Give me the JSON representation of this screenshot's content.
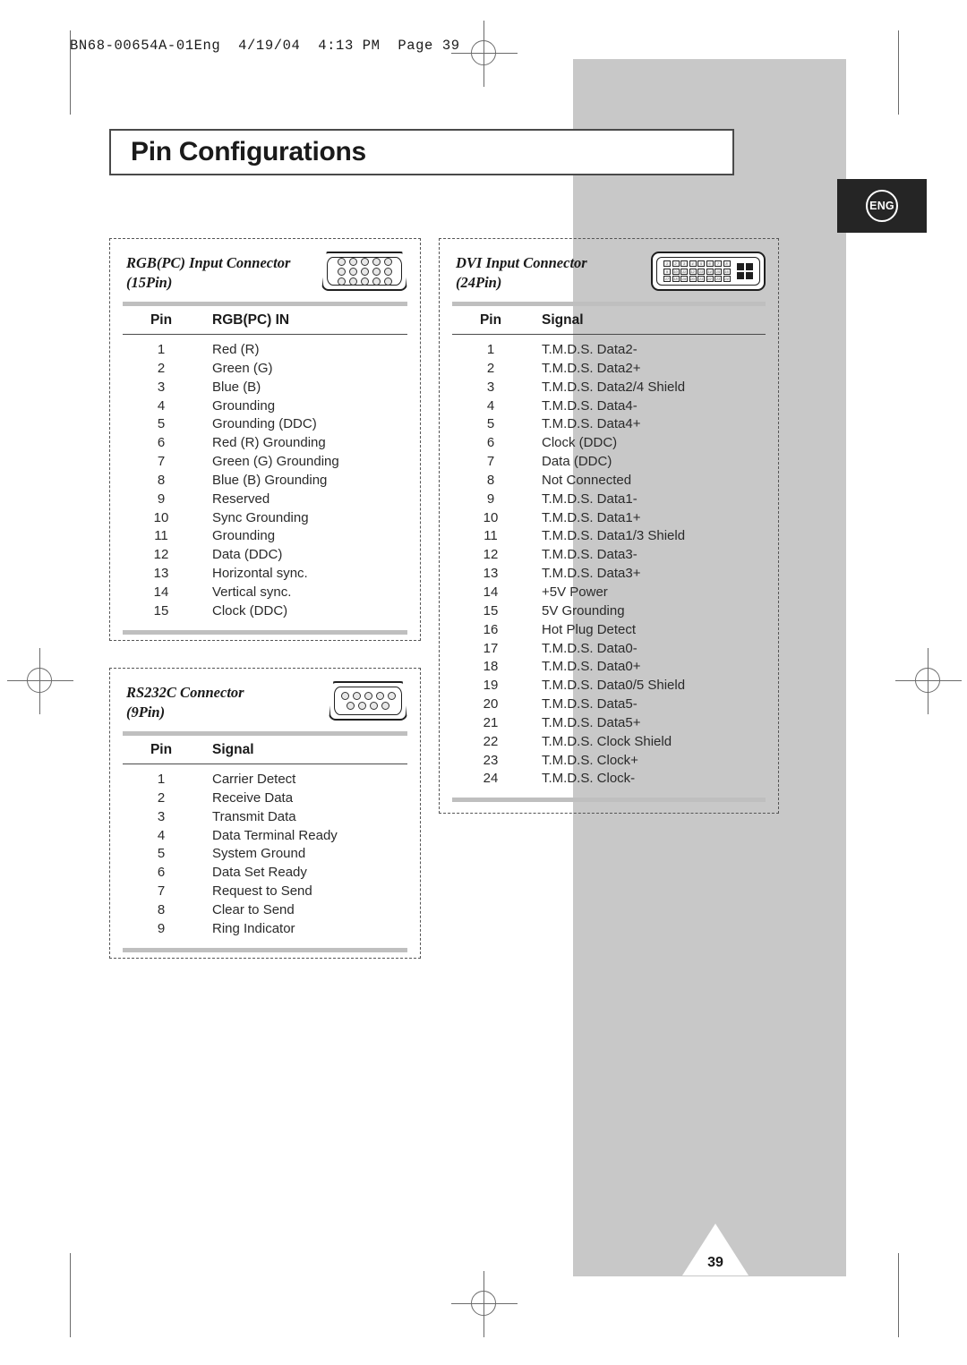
{
  "print_header": "BN68-00654A-01Eng  4/19/04  4:13 PM  Page 39",
  "page_title": "Pin Configurations",
  "language_badge": "ENG",
  "page_number": "39",
  "panels": [
    {
      "title": "RGB(PC) Input Connector",
      "subtitle": "(15Pin)",
      "connector_icon": "dsub-15pin-icon",
      "columns": [
        "Pin",
        "RGB(PC) IN"
      ],
      "rows": [
        [
          "1",
          "Red (R)"
        ],
        [
          "2",
          "Green (G)"
        ],
        [
          "3",
          "Blue (B)"
        ],
        [
          "4",
          "Grounding"
        ],
        [
          "5",
          "Grounding (DDC)"
        ],
        [
          "6",
          "Red (R) Grounding"
        ],
        [
          "7",
          "Green (G) Grounding"
        ],
        [
          "8",
          "Blue (B) Grounding"
        ],
        [
          "9",
          "Reserved"
        ],
        [
          "10",
          "Sync Grounding"
        ],
        [
          "11",
          "Grounding"
        ],
        [
          "12",
          "Data (DDC)"
        ],
        [
          "13",
          "Horizontal sync."
        ],
        [
          "14",
          "Vertical sync."
        ],
        [
          "15",
          "Clock (DDC)"
        ]
      ]
    },
    {
      "title": "DVI Input Connector",
      "subtitle": "(24Pin)",
      "connector_icon": "dvi-24pin-icon",
      "columns": [
        "Pin",
        "Signal"
      ],
      "rows": [
        [
          "1",
          "T.M.D.S. Data2-"
        ],
        [
          "2",
          "T.M.D.S. Data2+"
        ],
        [
          "3",
          "T.M.D.S. Data2/4 Shield"
        ],
        [
          "4",
          "T.M.D.S. Data4-"
        ],
        [
          "5",
          "T.M.D.S. Data4+"
        ],
        [
          "6",
          "Clock (DDC)"
        ],
        [
          "7",
          "Data (DDC)"
        ],
        [
          "8",
          "Not Connected"
        ],
        [
          "9",
          "T.M.D.S. Data1-"
        ],
        [
          "10",
          "T.M.D.S. Data1+"
        ],
        [
          "11",
          "T.M.D.S. Data1/3 Shield"
        ],
        [
          "12",
          "T.M.D.S. Data3-"
        ],
        [
          "13",
          "T.M.D.S. Data3+"
        ],
        [
          "14",
          "+5V Power"
        ],
        [
          "15",
          "5V Grounding"
        ],
        [
          "16",
          "Hot Plug Detect"
        ],
        [
          "17",
          "T.M.D.S. Data0-"
        ],
        [
          "18",
          "T.M.D.S. Data0+"
        ],
        [
          "19",
          "T.M.D.S. Data0/5 Shield"
        ],
        [
          "20",
          "T.M.D.S. Data5-"
        ],
        [
          "21",
          "T.M.D.S. Data5+"
        ],
        [
          "22",
          "T.M.D.S. Clock Shield"
        ],
        [
          "23",
          "T.M.D.S. Clock+"
        ],
        [
          "24",
          "T.M.D.S. Clock-"
        ]
      ]
    },
    {
      "title": "RS232C Connector",
      "subtitle": "(9Pin)",
      "connector_icon": "dsub-9pin-icon",
      "columns": [
        "Pin",
        "Signal"
      ],
      "rows": [
        [
          "1",
          "Carrier Detect"
        ],
        [
          "2",
          "Receive Data"
        ],
        [
          "3",
          "Transmit Data"
        ],
        [
          "4",
          "Data Terminal Ready"
        ],
        [
          "5",
          "System Ground"
        ],
        [
          "6",
          "Data Set Ready"
        ],
        [
          "7",
          "Request to Send"
        ],
        [
          "8",
          "Clear to Send"
        ],
        [
          "9",
          "Ring Indicator"
        ]
      ]
    }
  ],
  "colors": {
    "page_background": "#ffffff",
    "panel_gray": "#c8c8c8",
    "rule_gray": "#bfbfbf",
    "text": "#1a1a1a",
    "badge_dark": "#252525"
  }
}
